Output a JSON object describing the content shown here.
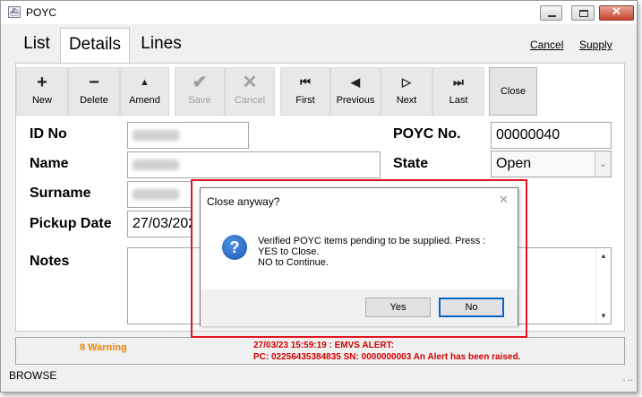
{
  "window": {
    "title": "POYC"
  },
  "tabs": {
    "list": "List",
    "details": "Details",
    "lines": "Lines"
  },
  "links": {
    "cancel": "Cancel",
    "supply": "Supply"
  },
  "toolbar": {
    "new": "New",
    "delete": "Delete",
    "amend": "Amend",
    "save": "Save",
    "cancel": "Cancel",
    "first": "First",
    "previous": "Previous",
    "next": "Next",
    "last": "Last",
    "close": "Close"
  },
  "form": {
    "id_label": "ID No",
    "name_label": "Name",
    "surname_label": "Surname",
    "pickup_label": "Pickup Date",
    "pickup_value": "27/03/202",
    "notes_label": "Notes",
    "poyc_label": "POYC No.",
    "poyc_value": "00000040",
    "state_label": "State",
    "state_value": "Open"
  },
  "status": {
    "warning": "8 Warning",
    "alert_line1": "27/03/23 15:59:19 : EMVS ALERT:",
    "alert_line2": "PC: 02256435384835 SN: 0000000003 An Alert has been raised.",
    "mode": "BROWSE"
  },
  "dialog": {
    "title": "Close anyway?",
    "message_line1": "Verified POYC items pending to be supplied. Press :",
    "message_line2": "YES to Close.",
    "message_line3": "NO to Continue.",
    "yes": "Yes",
    "no": "No"
  },
  "icons": {
    "new": "plus-icon",
    "delete": "minus-icon",
    "amend": "triangle-up-icon",
    "save": "check-icon",
    "cancel": "x-icon",
    "first": "first-icon",
    "previous": "previous-icon",
    "next": "next-icon",
    "last": "last-icon",
    "question": "question-icon"
  },
  "colors": {
    "warning": "#f08000",
    "alert": "#d00000",
    "highlight": "#e0141e",
    "default_button_border": "#0a63c8"
  }
}
